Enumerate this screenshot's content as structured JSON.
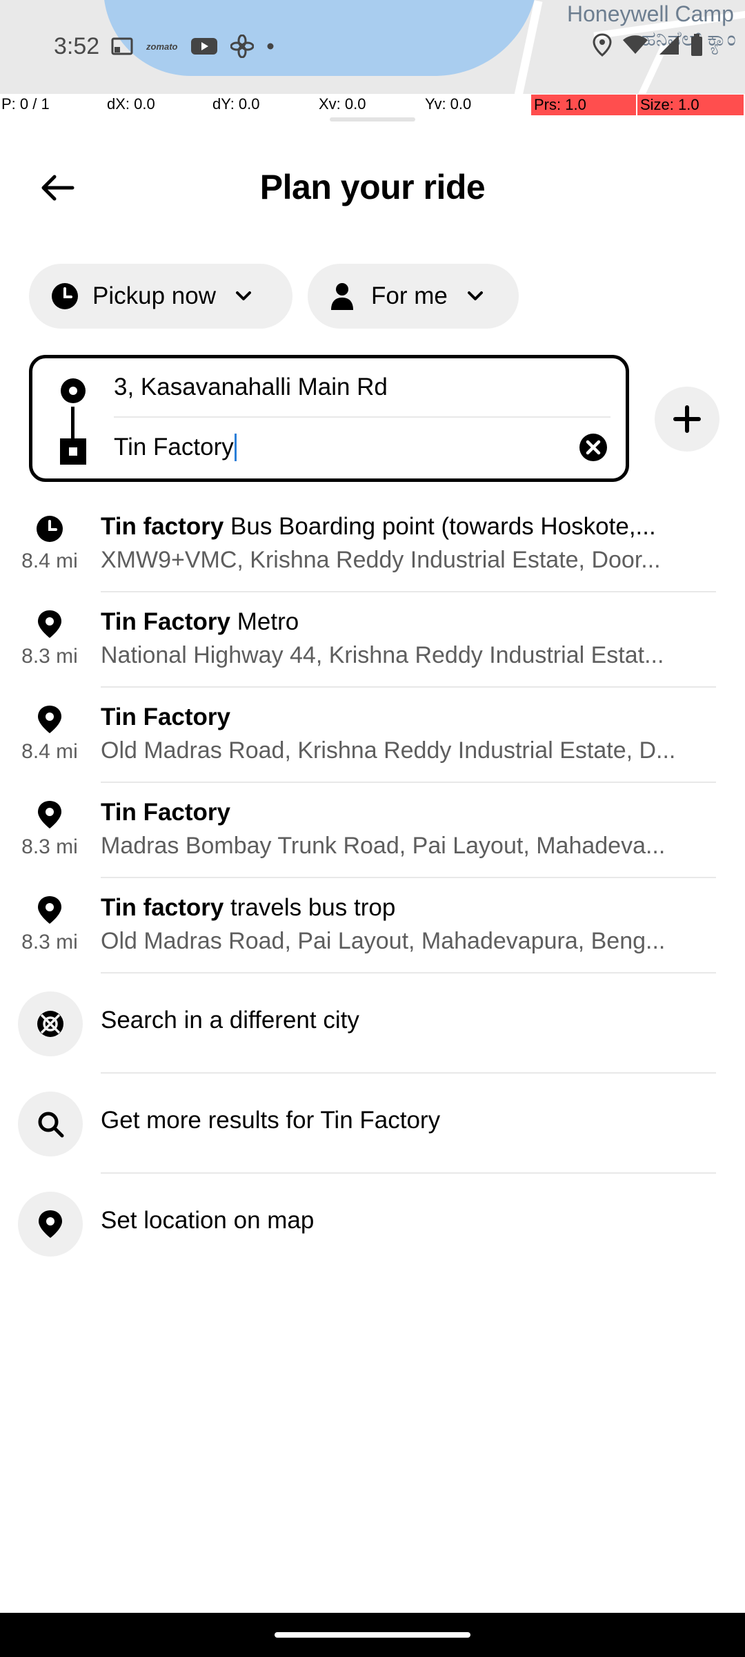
{
  "map": {
    "label_primary": "Honeywell Camp",
    "label_secondary": "ಹನಿವೆಲ್ ಕ್ಯಾಂ"
  },
  "status_bar": {
    "time": "3:52",
    "app_badge": "zomato"
  },
  "debug_overlay": {
    "pointer": "P: 0 / 1",
    "dx": "dX: 0.0",
    "dy": "dY: 0.0",
    "xv": "Xv: 0.0",
    "yv": "Yv: 0.0",
    "prs": "Prs: 1.0",
    "size": "Size: 1.0",
    "highlight_color": "#ff4e4e"
  },
  "header": {
    "title": "Plan your ride"
  },
  "chips": {
    "pickup": "Pickup now",
    "rider": "For me"
  },
  "route": {
    "pickup_value": "3, Kasavanahalli Main Rd",
    "destination_value": "Tin Factory",
    "caret_color": "#2b7fd8"
  },
  "results": [
    {
      "icon": "clock-icon",
      "bold": "Tin factory",
      "rest": " Bus Boarding point (towards Hoskote,...",
      "subtitle": "XMW9+VMC, Krishna Reddy Industrial Estate, Door...",
      "distance": "8.4 mi"
    },
    {
      "icon": "pin-icon",
      "bold": "Tin Factory",
      "rest": " Metro",
      "subtitle": "National Highway 44, Krishna Reddy Industrial Estat...",
      "distance": "8.3 mi"
    },
    {
      "icon": "pin-icon",
      "bold": "Tin Factory",
      "rest": "",
      "subtitle": "Old Madras Road, Krishna Reddy Industrial Estate, D...",
      "distance": "8.4 mi"
    },
    {
      "icon": "pin-icon",
      "bold": "Tin Factory",
      "rest": "",
      "subtitle": "Madras Bombay Trunk Road, Pai Layout, Mahadeva...",
      "distance": "8.3 mi"
    },
    {
      "icon": "pin-icon",
      "bold": "Tin factory",
      "rest": " travels bus trop",
      "subtitle": "Old Madras Road, Pai Layout, Mahadevapura, Beng...",
      "distance": "8.3 mi"
    }
  ],
  "actions": {
    "different_city": "Search in a different city",
    "more_results": "Get more results for Tin Factory",
    "set_on_map": "Set location on map"
  }
}
